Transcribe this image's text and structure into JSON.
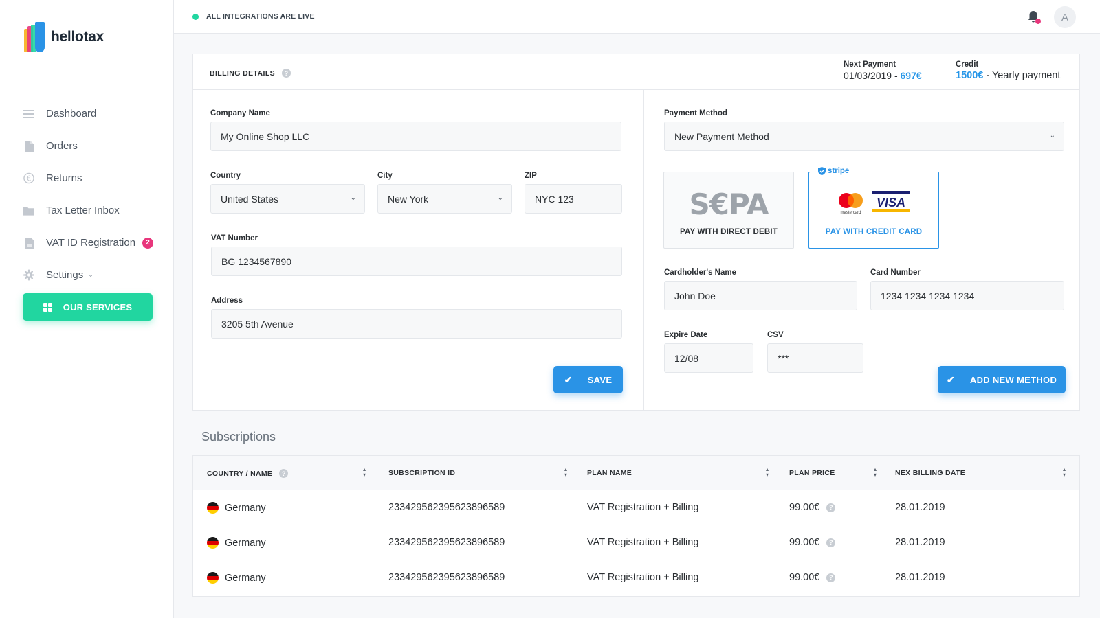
{
  "brand": {
    "name": "hellotax"
  },
  "sidebar": {
    "items": [
      {
        "label": "Dashboard",
        "icon": "menu-icon"
      },
      {
        "label": "Orders",
        "icon": "document-icon"
      },
      {
        "label": "Returns",
        "icon": "euro-icon"
      },
      {
        "label": "Tax Letter Inbox",
        "icon": "folder-icon"
      },
      {
        "label": "VAT ID Registration",
        "icon": "file-icon",
        "badge": "2"
      },
      {
        "label": "Settings",
        "icon": "gear-icon"
      }
    ],
    "services_label": "OUR SERVICES"
  },
  "topbar": {
    "status": "ALL INTEGRATIONS ARE LIVE",
    "avatar": "A"
  },
  "billing": {
    "title": "BILLING DETAILS",
    "next_payment": {
      "label": "Next Payment",
      "date": "01/03/2019 - ",
      "amount": "697€"
    },
    "credit": {
      "label": "Credit",
      "amount": "1500€",
      "suffix": " - Yearly payment"
    },
    "company_label": "Company Name",
    "company_value": "My Online Shop LLC",
    "country_label": "Country",
    "country_value": "United States",
    "city_label": "City",
    "city_value": "New York",
    "zip_label": "ZIP",
    "zip_value": "NYC 123",
    "vat_label": "VAT Number",
    "vat_value": "BG 1234567890",
    "address_label": "Address",
    "address_value": "3205 5th Avenue",
    "save_label": "SAVE"
  },
  "payment": {
    "method_label": "Payment Method",
    "method_value": "New Payment Method",
    "sepa_logo": "S€PA",
    "sepa_caption": "PAY WITH DIRECT DEBIT",
    "stripe_label": "stripe",
    "card_caption": "PAY WITH CREDIT CARD",
    "mastercard_text": "mastercard",
    "visa_text": "VISA",
    "holder_label": "Cardholder's Name",
    "holder_value": "John Doe",
    "number_label": "Card Number",
    "number_value": "1234 1234 1234 1234",
    "expire_label": "Expire Date",
    "expire_value": "12/08",
    "csv_label": "CSV",
    "csv_value": "***",
    "add_label": "ADD NEW METHOD"
  },
  "subscriptions": {
    "title": "Subscriptions",
    "columns": [
      "COUNTRY / NAME",
      "SUBSCRIPTION ID",
      "PLAN NAME",
      "PLAN PRICE",
      "NEX BILLING DATE"
    ],
    "rows": [
      {
        "country": "Germany",
        "id": "233429562395623896589",
        "plan": "VAT Registration + Billing",
        "price": "99.00€",
        "date": "28.01.2019"
      },
      {
        "country": "Germany",
        "id": "233429562395623896589",
        "plan": "VAT Registration + Billing",
        "price": "99.00€",
        "date": "28.01.2019"
      },
      {
        "country": "Germany",
        "id": "233429562395623896589",
        "plan": "VAT Registration + Billing",
        "price": "99.00€",
        "date": "28.01.2019"
      }
    ]
  },
  "colors": {
    "accent_green": "#21d6a0",
    "accent_blue": "#2a93e6",
    "badge_pink": "#e8367c"
  }
}
